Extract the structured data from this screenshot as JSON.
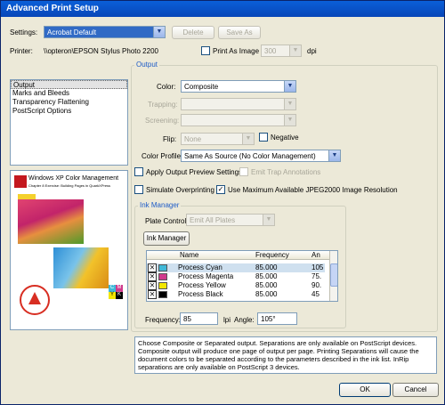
{
  "window": {
    "title": "Advanced Print Setup"
  },
  "settings": {
    "label": "Settings:",
    "value": "Acrobat Default",
    "delete_label": "Delete",
    "save_as_label": "Save As"
  },
  "printer": {
    "label": "Printer:",
    "value": "\\\\opteron\\EPSON Stylus Photo 2200",
    "print_as_image_label": "Print As Image",
    "dpi_value": "300",
    "dpi_unit": "dpi"
  },
  "categories": [
    "Output",
    "Marks and Bleeds",
    "Transparency Flattening",
    "PostScript Options"
  ],
  "preview": {
    "title": "Windows XP Color Management",
    "subtitle": "Chapter 8 Exercise: Building Pages in QuarkXPress",
    "cmyk": [
      "C",
      "M",
      "Y",
      "K"
    ]
  },
  "output": {
    "group_label": "Output",
    "color": {
      "label": "Color:",
      "value": "Composite"
    },
    "trapping": {
      "label": "Trapping:",
      "value": ""
    },
    "screening": {
      "label": "Screening:",
      "value": ""
    },
    "flip": {
      "label": "Flip:",
      "value": "None",
      "negative_label": "Negative"
    },
    "color_profile": {
      "label": "Color Profile:",
      "value": "Same As Source (No Color Management)"
    },
    "apply_preview_label": "Apply Output Preview Settings",
    "emit_trap_label": "Emit Trap Annotations",
    "simulate_overprint_label": "Simulate Overprinting",
    "use_jpeg2000_label": "Use Maximum Available JPEG2000 Image Resolution"
  },
  "ink_manager": {
    "group_label": "Ink Manager",
    "plate_control_label": "Plate Control",
    "plate_control_value": "Emit All Plates",
    "button_label": "Ink Manager",
    "columns": [
      "Name",
      "Frequency",
      "An"
    ],
    "inks": [
      {
        "name": "Process Cyan",
        "frequency": "85.000",
        "angle": "105",
        "color": "#3fb8d8"
      },
      {
        "name": "Process Magenta",
        "frequency": "85.000",
        "angle": "75.",
        "color": "#d03a8c"
      },
      {
        "name": "Process Yellow",
        "frequency": "85.000",
        "angle": "90.",
        "color": "#f2e600"
      },
      {
        "name": "Process Black",
        "frequency": "85.000",
        "angle": "45",
        "color": "#000000"
      }
    ],
    "frequency_label": "Frequency:",
    "frequency_value": "85",
    "frequency_unit": "lpi",
    "angle_label": "Angle:",
    "angle_value": "105°"
  },
  "help_text": "Choose Composite or Separated output. Separations are only available on PostScript devices. Composite output will produce one page of output per page. Printing Separations will cause the document colors to be separated according to the parameters described in the ink list. InRip separations are only available on PostScript 3 devices.",
  "footer": {
    "ok_label": "OK",
    "cancel_label": "Cancel"
  }
}
